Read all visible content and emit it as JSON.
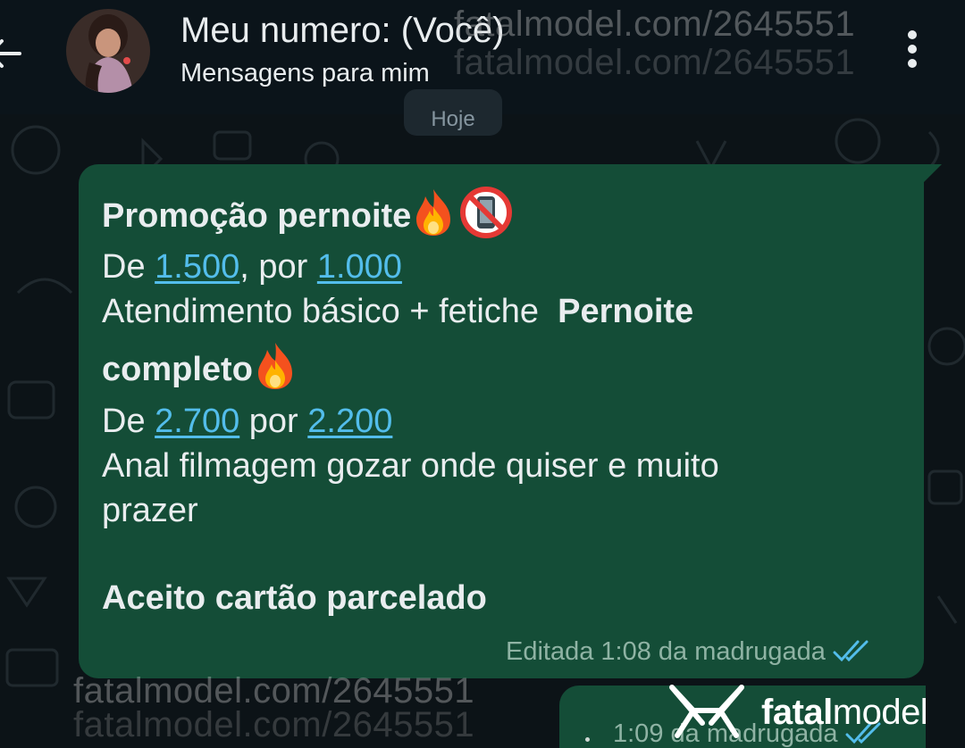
{
  "header": {
    "contact_name": "Meu numero: (Você)",
    "contact_subtitle": "Mensagens para mim",
    "back_icon": "arrow-left-icon",
    "menu_icon": "more-vertical-icon"
  },
  "date_chip": "Hoje",
  "watermark": {
    "text": "fatalmodel.com/2645551",
    "brand_prefix": "fatal",
    "brand_suffix": "model"
  },
  "message": {
    "line1_title": "Promoção pernoite",
    "line2_prefix": "De ",
    "line2_price_from": "1.500",
    "line2_mid": ", por ",
    "line2_price_to": "1.000",
    "line3_text": "Atendimento básico + fetiche  ",
    "line3_bold": "Pernoite",
    "line4_bold": "completo",
    "line5_prefix": "De ",
    "line5_price_from": "2.700",
    "line5_mid": " por ",
    "line5_price_to": "2.200",
    "line6_text": "Anal filmagem gozar onde quiser e muito",
    "line7_text": "prazer",
    "line8_bold": "Aceito cartão parcelado",
    "meta": "Editada 1:08 da madrugada"
  },
  "message2": {
    "meta": "1:09 da madrugada"
  },
  "colors": {
    "background": "#0c1317",
    "bubble": "#144d37",
    "link": "#53bdeb",
    "ticks": "#53bdeb"
  }
}
